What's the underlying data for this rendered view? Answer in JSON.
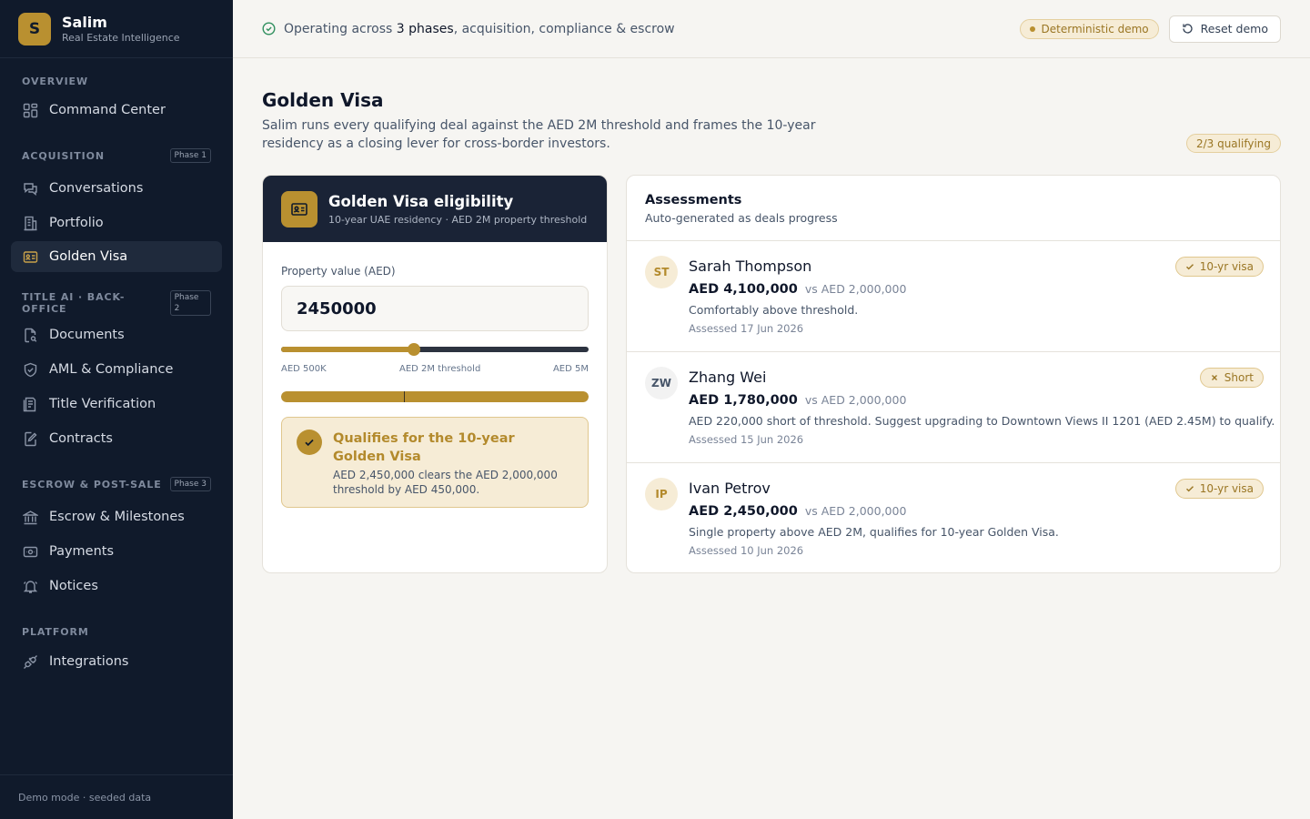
{
  "brand": {
    "logo_letter": "S",
    "name": "Salim",
    "subtitle": "Real Estate Intelligence"
  },
  "sidebar": {
    "groups": [
      {
        "label": "OVERVIEW",
        "phase": ""
      },
      {
        "label": "ACQUISITION",
        "phase": "Phase 1"
      },
      {
        "label": "TITLE AI · BACK-OFFICE",
        "phase": "Phase 2"
      },
      {
        "label": "ESCROW & POST-SALE",
        "phase": "Phase 3"
      },
      {
        "label": "PLATFORM",
        "phase": ""
      }
    ],
    "items": [
      {
        "label": "Command Center",
        "icon": "grid-icon"
      },
      {
        "label": "Conversations",
        "icon": "chat-icon"
      },
      {
        "label": "Portfolio",
        "icon": "building-icon"
      },
      {
        "label": "Golden Visa",
        "icon": "id-card-icon",
        "active": true
      },
      {
        "label": "Documents",
        "icon": "document-scan-icon"
      },
      {
        "label": "AML & Compliance",
        "icon": "shield-check-icon"
      },
      {
        "label": "Title Verification",
        "icon": "title-icon"
      },
      {
        "label": "Contracts",
        "icon": "contract-edit-icon"
      },
      {
        "label": "Escrow & Milestones",
        "icon": "bank-icon"
      },
      {
        "label": "Payments",
        "icon": "payment-icon"
      },
      {
        "label": "Notices",
        "icon": "bell-icon"
      },
      {
        "label": "Integrations",
        "icon": "plug-icon"
      }
    ],
    "footer": "Demo mode · seeded data"
  },
  "topbar": {
    "status_prefix": "Operating across ",
    "status_highlight": "3 phases",
    "status_suffix": ", acquisition, compliance & escrow",
    "demo_badge": "Deterministic demo",
    "reset_label": "Reset demo"
  },
  "page": {
    "title": "Golden Visa",
    "description": "Salim runs every qualifying deal against the AED 2M threshold and frames the 10-year residency as a closing lever for cross-border investors.",
    "qualifying_badge": "2/3 qualifying"
  },
  "eligibility": {
    "title": "Golden Visa eligibility",
    "subtitle": "10-year UAE residency · AED 2M property threshold",
    "field_label": "Property value (AED)",
    "property_value": "2450000",
    "slider": {
      "min": 500000,
      "max": 5000000,
      "value": 2450000,
      "threshold": 2000000
    },
    "slider_labels": {
      "min": "AED 500K",
      "threshold": "AED 2M threshold",
      "max": "AED 5M"
    },
    "progress_fraction": 1.0,
    "progress_marker_fraction": 0.4,
    "result_title": "Qualifies for the 10-year Golden Visa",
    "result_text": "AED 2,450,000 clears the AED 2,000,000 threshold by AED 450,000."
  },
  "assessments": {
    "title": "Assessments",
    "subtitle": "Auto-generated as deals progress",
    "rows": [
      {
        "initials": "ST",
        "name": "Sarah Thompson",
        "amount": "AED 4,100,000",
        "vs": "vs AED 2,000,000",
        "note": "Comfortably above threshold.",
        "assessed": "Assessed 17 Jun 2026",
        "status": "10-yr visa",
        "status_icon": "check-icon",
        "avatar_bg": "#f6ecd6",
        "avatar_fg": "#b38a2c"
      },
      {
        "initials": "ZW",
        "name": "Zhang Wei",
        "amount": "AED 1,780,000",
        "vs": "vs AED 2,000,000",
        "note": "AED 220,000 short of threshold. Suggest upgrading to Downtown Views II 1201 (AED 2.45M) to qualify.",
        "assessed": "Assessed 15 Jun 2026",
        "status": "Short",
        "status_icon": "x-icon",
        "avatar_bg": "#f2f2f2",
        "avatar_fg": "#475569"
      },
      {
        "initials": "IP",
        "name": "Ivan Petrov",
        "amount": "AED 2,450,000",
        "vs": "vs AED 2,000,000",
        "note": "Single property above AED 2M, qualifies for 10-year Golden Visa.",
        "assessed": "Assessed 10 Jun 2026",
        "status": "10-yr visa",
        "status_icon": "check-icon",
        "avatar_bg": "#f6ecd6",
        "avatar_fg": "#b38a2c"
      }
    ]
  },
  "colors": {
    "accent": "#b99030",
    "sidebar_bg": "#101a2b",
    "card_header_bg": "#1a2336"
  }
}
